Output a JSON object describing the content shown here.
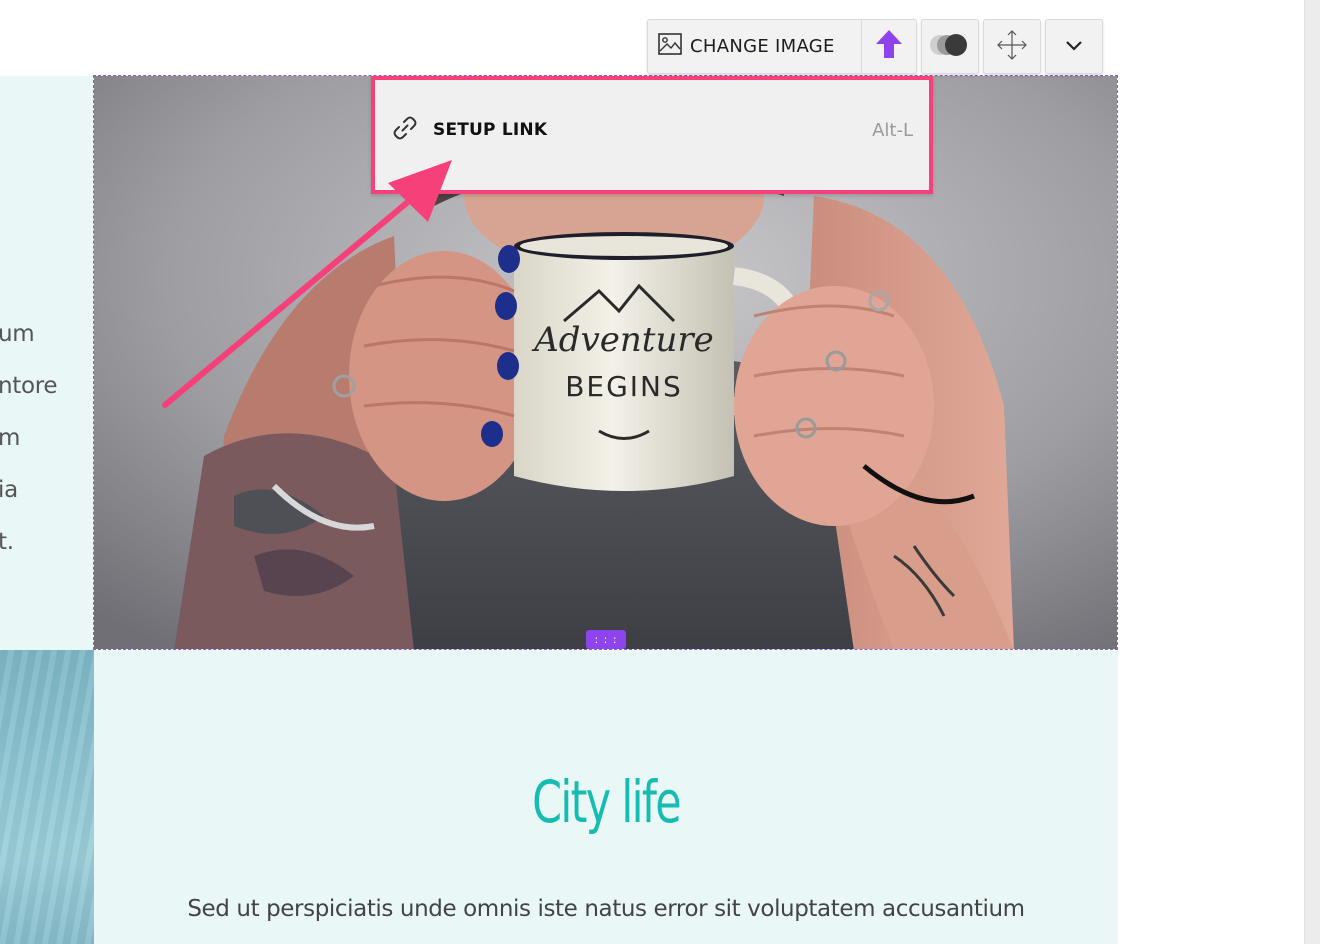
{
  "toolbar": {
    "change_image_label": "CHANGE IMAGE",
    "icons": {
      "change_image": "image-icon",
      "upload": "upload-arrow-icon",
      "opacity": "opacity-toggle-icon",
      "move": "move-arrows-icon",
      "more": "chevron-down-icon"
    },
    "accent_color": "#8e44ec"
  },
  "link_menu": {
    "icon": "link-icon",
    "label": "SETUP LINK",
    "shortcut": "Alt-L",
    "highlight_color": "#f5407a"
  },
  "left_text_fragments": [
    "um",
    "ntore",
    "m",
    "ia",
    "t."
  ],
  "image": {
    "description_icon": "photo",
    "selection_border_color": "#8c5bd6",
    "drag_handle": "drag-handle-icon"
  },
  "section": {
    "title": "City life",
    "body": "Sed ut perspiciatis unde omnis iste natus error sit voluptatem accusantium",
    "title_color": "#16bcb1",
    "background_color": "#e9f8f7"
  }
}
